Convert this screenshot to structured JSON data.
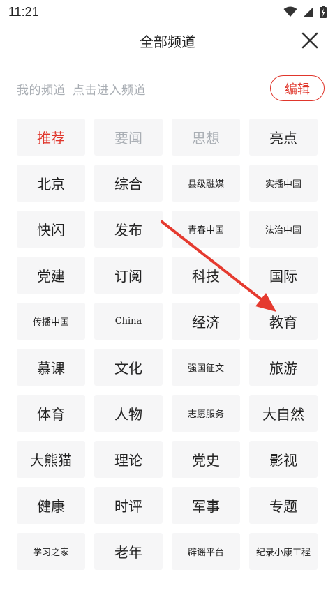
{
  "status_bar": {
    "time": "11:21"
  },
  "header": {
    "title": "全部频道"
  },
  "subbar": {
    "my_channels": "我的频道",
    "hint": "点击进入频道",
    "edit_label": "编辑"
  },
  "channels": [
    {
      "label": "推荐",
      "state": "active"
    },
    {
      "label": "要闻",
      "state": "fixed"
    },
    {
      "label": "思想",
      "state": "fixed"
    },
    {
      "label": "亮点",
      "state": "normal"
    },
    {
      "label": "北京",
      "state": "normal"
    },
    {
      "label": "综合",
      "state": "normal"
    },
    {
      "label": "县级融媒",
      "state": "normal"
    },
    {
      "label": "实播中国",
      "state": "normal"
    },
    {
      "label": "快闪",
      "state": "normal"
    },
    {
      "label": "发布",
      "state": "normal"
    },
    {
      "label": "青春中国",
      "state": "normal"
    },
    {
      "label": "法治中国",
      "state": "normal"
    },
    {
      "label": "党建",
      "state": "normal"
    },
    {
      "label": "订阅",
      "state": "normal"
    },
    {
      "label": "科技",
      "state": "normal"
    },
    {
      "label": "国际",
      "state": "normal"
    },
    {
      "label": "传播中国",
      "state": "normal"
    },
    {
      "label": "China",
      "state": "normal"
    },
    {
      "label": "经济",
      "state": "normal"
    },
    {
      "label": "教育",
      "state": "normal"
    },
    {
      "label": "慕课",
      "state": "normal"
    },
    {
      "label": "文化",
      "state": "normal"
    },
    {
      "label": "强国征文",
      "state": "normal"
    },
    {
      "label": "旅游",
      "state": "normal"
    },
    {
      "label": "体育",
      "state": "normal"
    },
    {
      "label": "人物",
      "state": "normal"
    },
    {
      "label": "志愿服务",
      "state": "normal"
    },
    {
      "label": "大自然",
      "state": "normal"
    },
    {
      "label": "大熊猫",
      "state": "normal"
    },
    {
      "label": "理论",
      "state": "normal"
    },
    {
      "label": "党史",
      "state": "normal"
    },
    {
      "label": "影视",
      "state": "normal"
    },
    {
      "label": "健康",
      "state": "normal"
    },
    {
      "label": "时评",
      "state": "normal"
    },
    {
      "label": "军事",
      "state": "normal"
    },
    {
      "label": "专题",
      "state": "normal"
    },
    {
      "label": "学习之家",
      "state": "normal"
    },
    {
      "label": "老年",
      "state": "normal"
    },
    {
      "label": "辟谣平台",
      "state": "normal"
    },
    {
      "label": "纪录小康工程",
      "state": "normal"
    }
  ],
  "colors": {
    "accent": "#e0362c",
    "muted": "#a9aeb4",
    "cell_bg": "#f6f6f7"
  }
}
